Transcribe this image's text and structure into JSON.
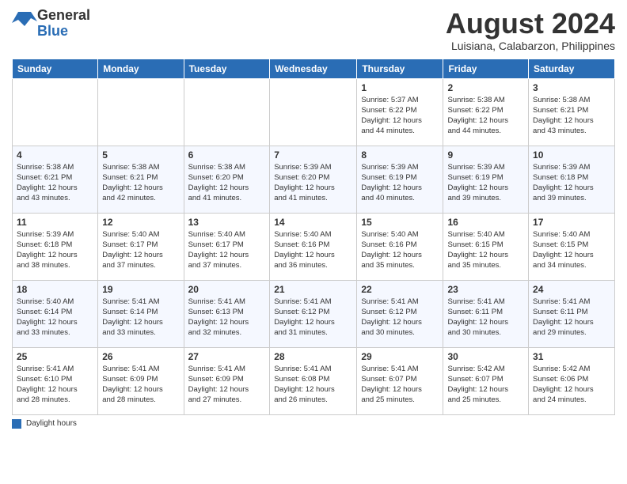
{
  "logo": {
    "general": "General",
    "blue": "Blue"
  },
  "title": "August 2024",
  "location": "Luisiana, Calabarzon, Philippines",
  "days_of_week": [
    "Sunday",
    "Monday",
    "Tuesday",
    "Wednesday",
    "Thursday",
    "Friday",
    "Saturday"
  ],
  "weeks": [
    [
      {
        "day": "",
        "info": ""
      },
      {
        "day": "",
        "info": ""
      },
      {
        "day": "",
        "info": ""
      },
      {
        "day": "",
        "info": ""
      },
      {
        "day": "1",
        "info": "Sunrise: 5:37 AM\nSunset: 6:22 PM\nDaylight: 12 hours\nand 44 minutes."
      },
      {
        "day": "2",
        "info": "Sunrise: 5:38 AM\nSunset: 6:22 PM\nDaylight: 12 hours\nand 44 minutes."
      },
      {
        "day": "3",
        "info": "Sunrise: 5:38 AM\nSunset: 6:21 PM\nDaylight: 12 hours\nand 43 minutes."
      }
    ],
    [
      {
        "day": "4",
        "info": "Sunrise: 5:38 AM\nSunset: 6:21 PM\nDaylight: 12 hours\nand 43 minutes."
      },
      {
        "day": "5",
        "info": "Sunrise: 5:38 AM\nSunset: 6:21 PM\nDaylight: 12 hours\nand 42 minutes."
      },
      {
        "day": "6",
        "info": "Sunrise: 5:38 AM\nSunset: 6:20 PM\nDaylight: 12 hours\nand 41 minutes."
      },
      {
        "day": "7",
        "info": "Sunrise: 5:39 AM\nSunset: 6:20 PM\nDaylight: 12 hours\nand 41 minutes."
      },
      {
        "day": "8",
        "info": "Sunrise: 5:39 AM\nSunset: 6:19 PM\nDaylight: 12 hours\nand 40 minutes."
      },
      {
        "day": "9",
        "info": "Sunrise: 5:39 AM\nSunset: 6:19 PM\nDaylight: 12 hours\nand 39 minutes."
      },
      {
        "day": "10",
        "info": "Sunrise: 5:39 AM\nSunset: 6:18 PM\nDaylight: 12 hours\nand 39 minutes."
      }
    ],
    [
      {
        "day": "11",
        "info": "Sunrise: 5:39 AM\nSunset: 6:18 PM\nDaylight: 12 hours\nand 38 minutes."
      },
      {
        "day": "12",
        "info": "Sunrise: 5:40 AM\nSunset: 6:17 PM\nDaylight: 12 hours\nand 37 minutes."
      },
      {
        "day": "13",
        "info": "Sunrise: 5:40 AM\nSunset: 6:17 PM\nDaylight: 12 hours\nand 37 minutes."
      },
      {
        "day": "14",
        "info": "Sunrise: 5:40 AM\nSunset: 6:16 PM\nDaylight: 12 hours\nand 36 minutes."
      },
      {
        "day": "15",
        "info": "Sunrise: 5:40 AM\nSunset: 6:16 PM\nDaylight: 12 hours\nand 35 minutes."
      },
      {
        "day": "16",
        "info": "Sunrise: 5:40 AM\nSunset: 6:15 PM\nDaylight: 12 hours\nand 35 minutes."
      },
      {
        "day": "17",
        "info": "Sunrise: 5:40 AM\nSunset: 6:15 PM\nDaylight: 12 hours\nand 34 minutes."
      }
    ],
    [
      {
        "day": "18",
        "info": "Sunrise: 5:40 AM\nSunset: 6:14 PM\nDaylight: 12 hours\nand 33 minutes."
      },
      {
        "day": "19",
        "info": "Sunrise: 5:41 AM\nSunset: 6:14 PM\nDaylight: 12 hours\nand 33 minutes."
      },
      {
        "day": "20",
        "info": "Sunrise: 5:41 AM\nSunset: 6:13 PM\nDaylight: 12 hours\nand 32 minutes."
      },
      {
        "day": "21",
        "info": "Sunrise: 5:41 AM\nSunset: 6:12 PM\nDaylight: 12 hours\nand 31 minutes."
      },
      {
        "day": "22",
        "info": "Sunrise: 5:41 AM\nSunset: 6:12 PM\nDaylight: 12 hours\nand 30 minutes."
      },
      {
        "day": "23",
        "info": "Sunrise: 5:41 AM\nSunset: 6:11 PM\nDaylight: 12 hours\nand 30 minutes."
      },
      {
        "day": "24",
        "info": "Sunrise: 5:41 AM\nSunset: 6:11 PM\nDaylight: 12 hours\nand 29 minutes."
      }
    ],
    [
      {
        "day": "25",
        "info": "Sunrise: 5:41 AM\nSunset: 6:10 PM\nDaylight: 12 hours\nand 28 minutes."
      },
      {
        "day": "26",
        "info": "Sunrise: 5:41 AM\nSunset: 6:09 PM\nDaylight: 12 hours\nand 28 minutes."
      },
      {
        "day": "27",
        "info": "Sunrise: 5:41 AM\nSunset: 6:09 PM\nDaylight: 12 hours\nand 27 minutes."
      },
      {
        "day": "28",
        "info": "Sunrise: 5:41 AM\nSunset: 6:08 PM\nDaylight: 12 hours\nand 26 minutes."
      },
      {
        "day": "29",
        "info": "Sunrise: 5:41 AM\nSunset: 6:07 PM\nDaylight: 12 hours\nand 25 minutes."
      },
      {
        "day": "30",
        "info": "Sunrise: 5:42 AM\nSunset: 6:07 PM\nDaylight: 12 hours\nand 25 minutes."
      },
      {
        "day": "31",
        "info": "Sunrise: 5:42 AM\nSunset: 6:06 PM\nDaylight: 12 hours\nand 24 minutes."
      }
    ]
  ],
  "legend_label": "Daylight hours"
}
